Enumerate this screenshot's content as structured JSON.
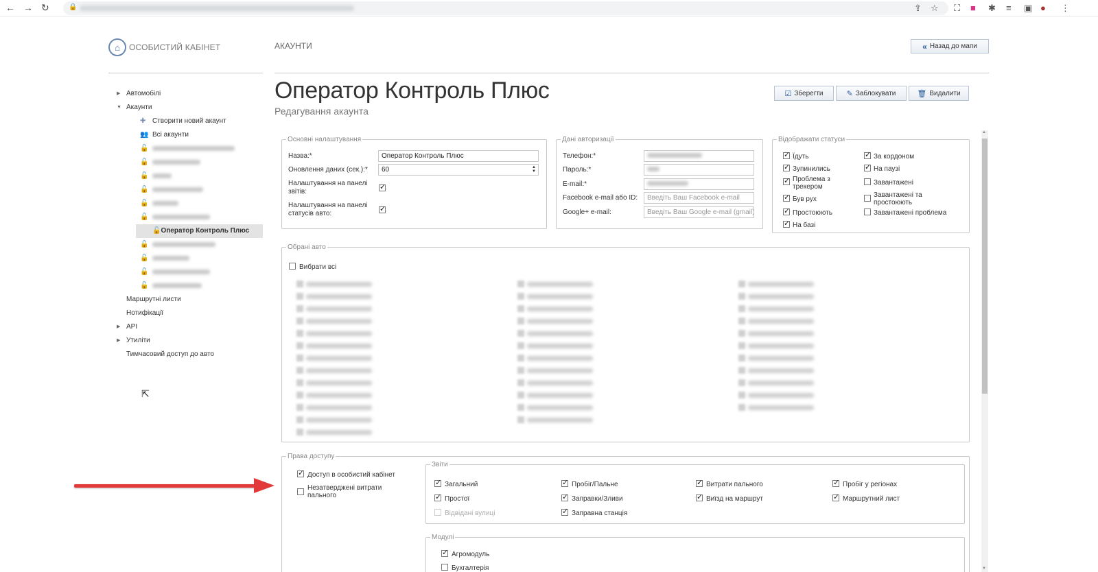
{
  "header": {
    "logo_text": "ОСОБИСТИЙ КАБІНЕТ",
    "section": "АКАУНТИ",
    "back_button": "Назад до мапи"
  },
  "sidebar": {
    "items": [
      {
        "label": "Автомобілі"
      },
      {
        "label": "Акаунти"
      },
      {
        "label": "Створити новий акаунт"
      },
      {
        "label": "Всі акаунти"
      },
      {
        "label": "Оператор Контроль Плюс"
      },
      {
        "label": "Маршрутні листи"
      },
      {
        "label": "Нотифікації"
      },
      {
        "label": "API"
      },
      {
        "label": "Утиліти"
      },
      {
        "label": "Тимчасовий доступ до авто"
      }
    ]
  },
  "page": {
    "title": "Оператор Контроль Плюс",
    "subtitle": "Редагування акаунта"
  },
  "toolbar": {
    "save": "Зберегти",
    "block": "Заблокувати",
    "delete": "Видалити"
  },
  "basic": {
    "legend": "Основні налаштування",
    "name_label": "Назва:*",
    "name_value": "Оператор Контроль Плюс",
    "refresh_label": "Оновлення даних (сек.):*",
    "refresh_value": "60",
    "reports_panel_label": "Налаштування на панелі звітів:",
    "status_panel_label": "Налаштування на панелі статусів авто:"
  },
  "auth": {
    "legend": "Дані авторизації",
    "phone_label": "Телефон:*",
    "password_label": "Пароль:*",
    "email_label": "E-mail:*",
    "facebook_label": "Facebook e-mail або ID:",
    "facebook_placeholder": "Введіть Ваш Facebook e-mail",
    "google_label": "Google+ e-mail:",
    "google_placeholder": "Введіть Ваш Google e-mail (gmail)"
  },
  "statuses": {
    "legend": "Відображати статуси",
    "left": [
      {
        "label": "Їдуть",
        "checked": true
      },
      {
        "label": "Зупинились",
        "checked": true
      },
      {
        "label": "Проблема з трекером",
        "checked": true
      },
      {
        "label": "Був рух",
        "checked": true
      },
      {
        "label": "Простоюють",
        "checked": true
      },
      {
        "label": "На базі",
        "checked": true
      }
    ],
    "right": [
      {
        "label": "За кордоном",
        "checked": true
      },
      {
        "label": "На паузі",
        "checked": true
      },
      {
        "label": "Завантажені",
        "checked": false
      },
      {
        "label": "Завантажені та простоюють",
        "checked": false
      },
      {
        "label": "Завантажені проблема",
        "checked": false
      }
    ]
  },
  "cars": {
    "legend": "Обрані авто",
    "select_all": "Вибрати всі"
  },
  "access": {
    "legend": "Права доступу",
    "cabinet_access": "Доступ в особистий кабінет",
    "unconfirmed_fuel": "Незатверджені витрати пального",
    "reports": {
      "legend": "Звіти",
      "items": [
        {
          "label": "Загальний",
          "checked": true
        },
        {
          "label": "Пробіг/Пальне",
          "checked": true
        },
        {
          "label": "Витрати пального",
          "checked": true
        },
        {
          "label": "Пробіг у регіонах",
          "checked": true
        },
        {
          "label": "Простої",
          "checked": true
        },
        {
          "label": "Заправки/Зливи",
          "checked": true
        },
        {
          "label": "Виїзд на маршрут",
          "checked": true
        },
        {
          "label": "Маршрутний лист",
          "checked": true
        },
        {
          "label": "Відвідані вулиці",
          "checked": false
        },
        {
          "label": "Заправна станція",
          "checked": true
        }
      ]
    },
    "modules": {
      "legend": "Модулі",
      "items": [
        {
          "label": "Агромодуль",
          "checked": true
        },
        {
          "label": "Бухгалтерія",
          "checked": false
        }
      ]
    }
  }
}
